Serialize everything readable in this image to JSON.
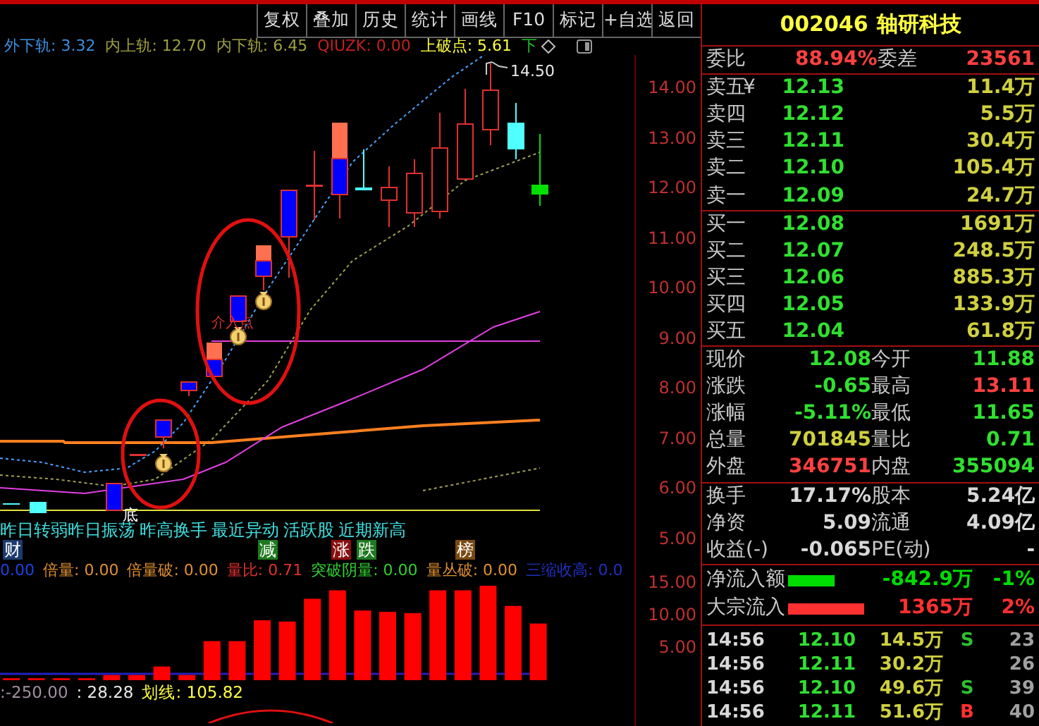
{
  "toolbar": [
    "复权",
    "叠加",
    "历史",
    "统计",
    "画线",
    "F10",
    "标记",
    "+自选",
    "返回"
  ],
  "legend": [
    {
      "text": "外下轨: 3.32",
      "color": "#3a8ee0"
    },
    {
      "text": "内上轨: 12.70",
      "color": "#a0a040"
    },
    {
      "text": "内下轨: 6.45",
      "color": "#a0a040"
    },
    {
      "text": "QIUZK: 0.00",
      "color": "#c02020"
    },
    {
      "text": "上破点: 5.61",
      "color": "#ffff40"
    },
    {
      "text": "下",
      "color": "#20c020"
    }
  ],
  "price_chart": {
    "high_label": "14.50",
    "entry_label": "介入点",
    "bottom_label": "底",
    "axis": [
      "14.00",
      "13.00",
      "12.00",
      "11.00",
      "10.00",
      "9.00",
      "8.00",
      "7.00",
      "6.00",
      "5.00"
    ]
  },
  "signals": [
    "昨日转弱昨日振荡",
    "昨高换手",
    "最近异动",
    "活跃股",
    "近期新高"
  ],
  "tags": [
    {
      "text": "财",
      "color": "#1c3a6e"
    },
    {
      "text": "减",
      "color": "#1f7a1f"
    },
    {
      "text": "涨",
      "color": "#8a1010"
    },
    {
      "text": "跌",
      "color": "#1f7a1f"
    },
    {
      "text": "榜",
      "color": "#7a4a10"
    }
  ],
  "indicators": [
    {
      "text": "0.00",
      "color": "#2040e0"
    },
    {
      "text": "倍量: 0.00",
      "color": "#e09030"
    },
    {
      "text": "倍量破: 0.00",
      "color": "#e09030"
    },
    {
      "text": "量比: 0.71",
      "color": "#e03030"
    },
    {
      "text": "突破阴量: 0.00",
      "color": "#30d030"
    },
    {
      "text": "量丛破: 0.00",
      "color": "#e09030"
    },
    {
      "text": "三缩收高: 0.0",
      "color": "#2030c0"
    }
  ],
  "volume_chart": {
    "axis": [
      "15.00",
      "10.00",
      "5.00"
    ]
  },
  "readouts": [
    {
      "text": ":-250.00",
      "color": "#a090a0"
    },
    {
      "text": ": 28.28",
      "color": "#e8e8e8"
    },
    {
      "text": "划线: 105.82",
      "color": "#ffff40"
    }
  ],
  "quote": {
    "code": "002046",
    "name": "轴研科技",
    "ratio": {
      "label": "委比",
      "value": "88.94%",
      "label2": "委差",
      "value2": "23561"
    },
    "asks": [
      {
        "label": "卖五",
        "symbol": "¥",
        "price": "12.13",
        "volume": "11.4万"
      },
      {
        "label": "卖四",
        "price": "12.12",
        "volume": "5.5万"
      },
      {
        "label": "卖三",
        "price": "12.11",
        "volume": "30.4万"
      },
      {
        "label": "卖二",
        "price": "12.10",
        "volume": "105.4万"
      },
      {
        "label": "卖一",
        "price": "12.09",
        "volume": "24.7万"
      }
    ],
    "bids": [
      {
        "label": "买一",
        "price": "12.08",
        "volume": "1691万"
      },
      {
        "label": "买二",
        "price": "12.07",
        "volume": "248.5万"
      },
      {
        "label": "买三",
        "price": "12.06",
        "volume": "885.3万"
      },
      {
        "label": "买四",
        "price": "12.05",
        "volume": "133.9万"
      },
      {
        "label": "买五",
        "price": "12.04",
        "volume": "61.8万"
      }
    ],
    "stats": [
      {
        "left": {
          "label": "现价",
          "value": "12.08",
          "color": "#30e030"
        },
        "right": {
          "label": "今开",
          "value": "11.88",
          "color": "#30e030"
        }
      },
      {
        "left": {
          "label": "涨跌",
          "value": "-0.65",
          "color": "#30e030"
        },
        "right": {
          "label": "最高",
          "value": "13.11",
          "color": "#ff4040"
        }
      },
      {
        "left": {
          "label": "涨幅",
          "value": "-5.11%",
          "color": "#30e030"
        },
        "right": {
          "label": "最低",
          "value": "11.65",
          "color": "#30e030"
        }
      },
      {
        "left": {
          "label": "总量",
          "value": "701845",
          "color": "#d0d040"
        },
        "right": {
          "label": "量比",
          "value": "0.71",
          "color": "#30e030"
        }
      },
      {
        "left": {
          "label": "外盘",
          "value": "346751",
          "color": "#ff4040"
        },
        "right": {
          "label": "内盘",
          "value": "355094",
          "color": "#30e030"
        }
      }
    ],
    "capital": [
      {
        "label": "换手",
        "value": "17.17%",
        "label2": "股本",
        "value2": "5.24亿"
      },
      {
        "label": "净资",
        "value": "5.09",
        "label2": "流通",
        "value2": "4.09亿"
      },
      {
        "label": "收益(-)",
        "value": "-0.065",
        "label2": "PE(动)",
        "value2": "-"
      }
    ],
    "flows": [
      {
        "label": "净流入额",
        "color": "#00dd00",
        "value": "-842.9万",
        "pct": "-1%"
      },
      {
        "label": "大宗流入",
        "color": "#ff3030",
        "value": "1365万",
        "pct": "2%"
      }
    ],
    "ticks": [
      {
        "time": "14:56",
        "price": "12.10",
        "volume": "14.5万",
        "side": "S",
        "color": "#30c030",
        "count": "23"
      },
      {
        "time": "14:56",
        "price": "12.11",
        "volume": "30.2万",
        "count": "26"
      },
      {
        "time": "14:56",
        "price": "12.10",
        "volume": "49.6万",
        "side": "S",
        "color": "#30c030",
        "count": "39"
      },
      {
        "time": "14:56",
        "price": "12.11",
        "volume": "51.6万",
        "side": "B",
        "color": "#ff3030",
        "count": "40"
      }
    ]
  }
}
